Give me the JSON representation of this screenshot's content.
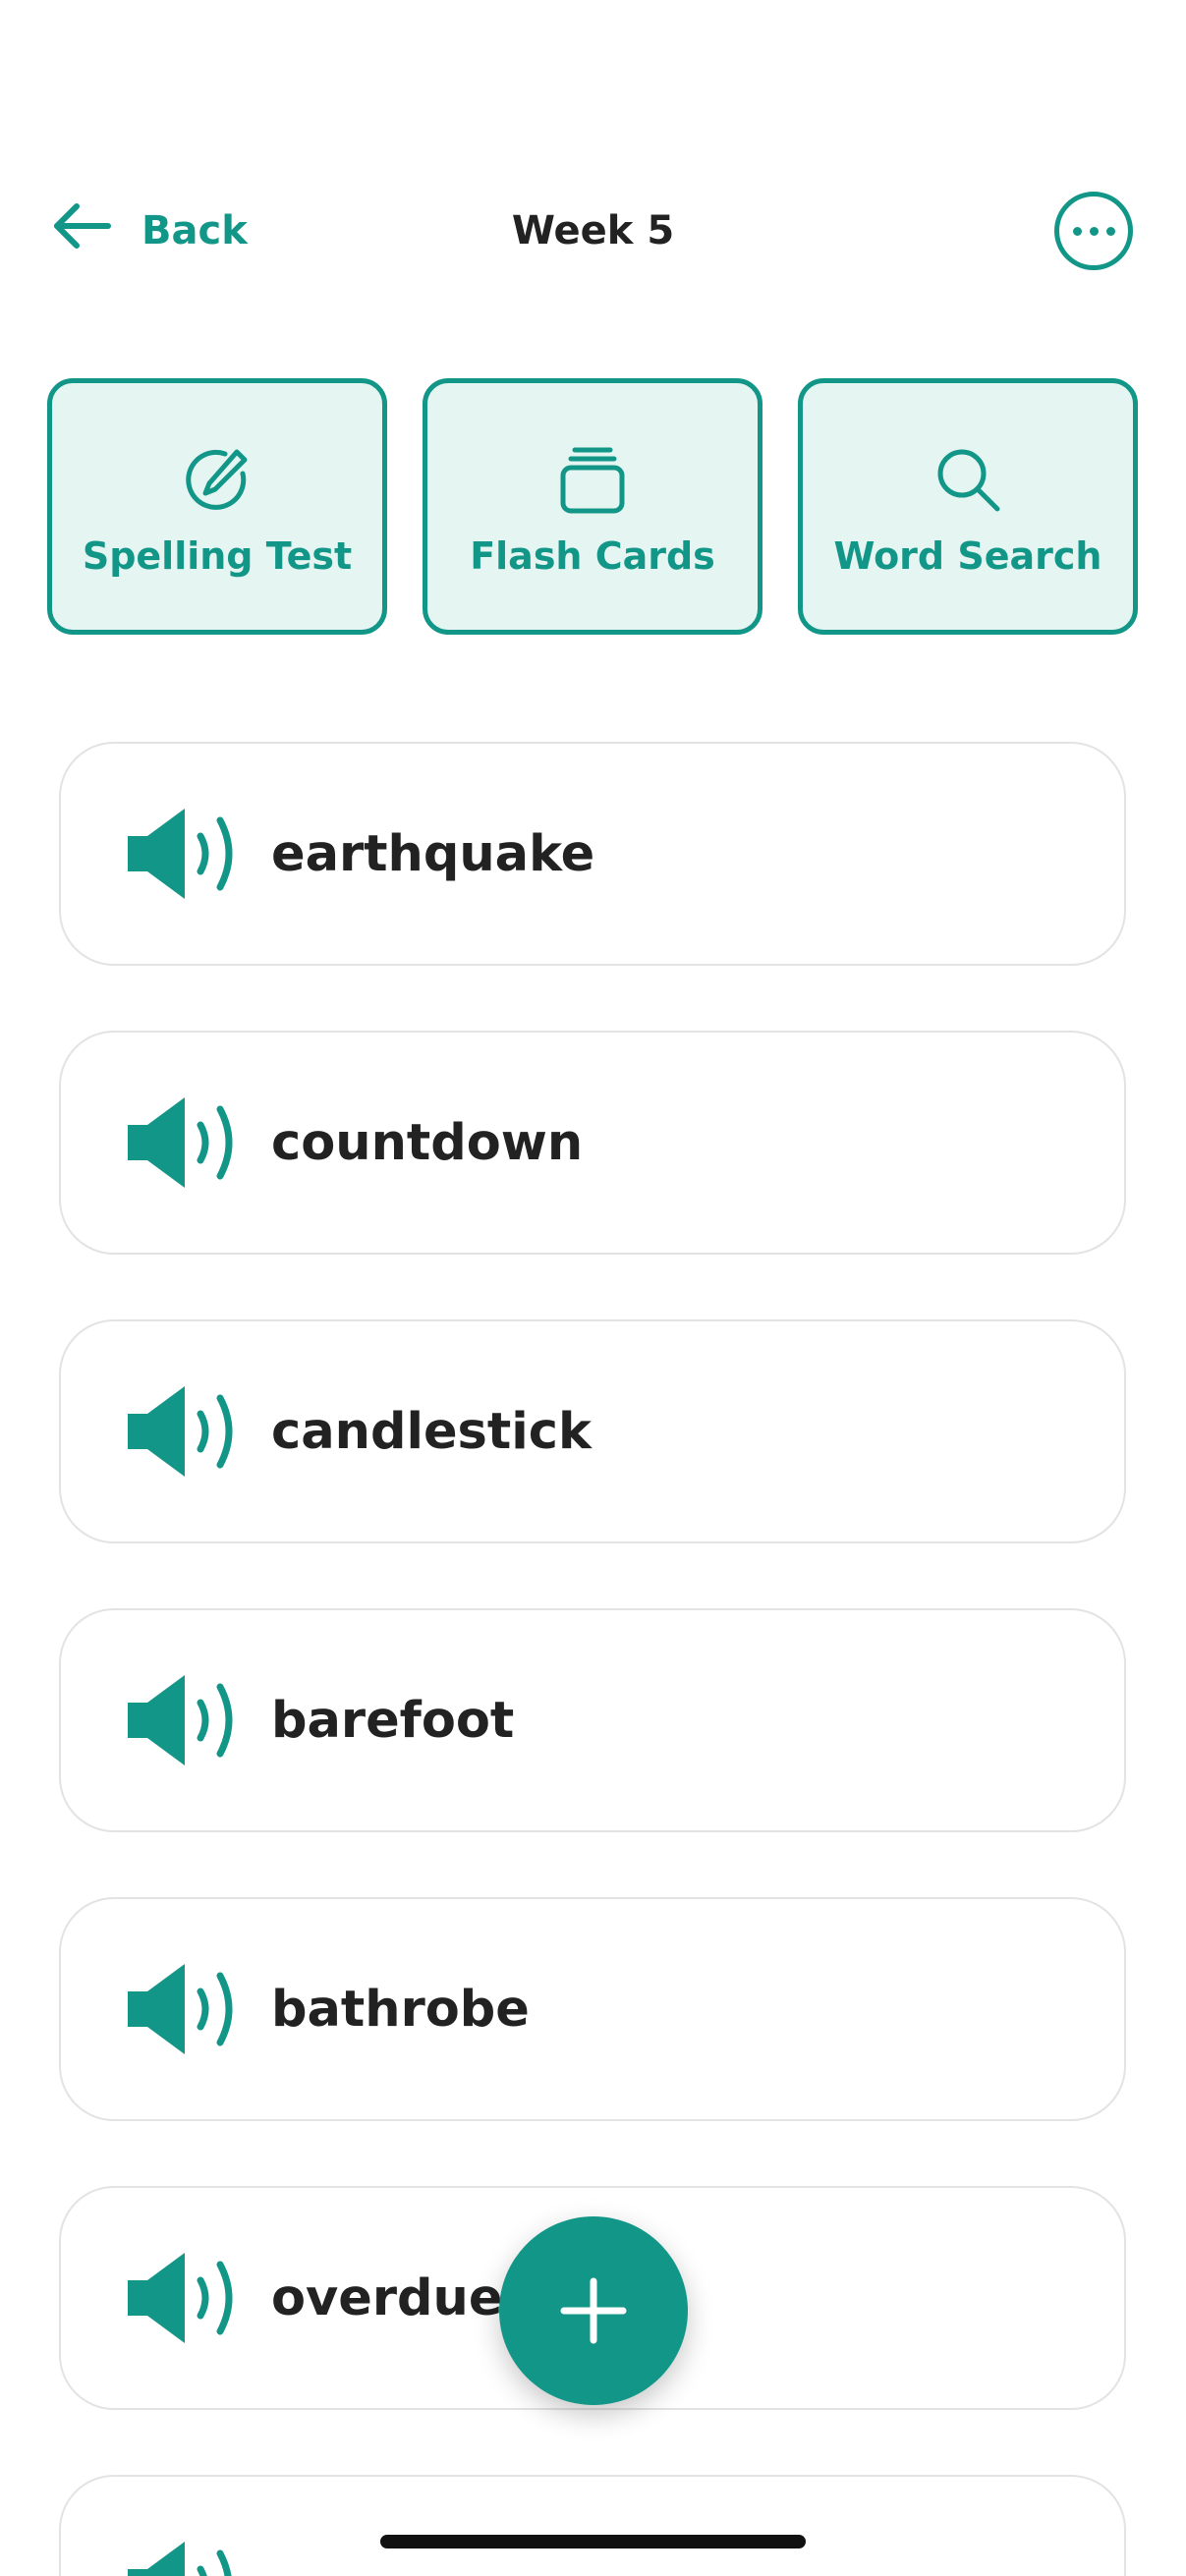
{
  "header": {
    "back_label": "Back",
    "title": "Week 5"
  },
  "activities": [
    {
      "label": "Spelling Test",
      "icon": "pencil-circle-icon"
    },
    {
      "label": "Flash Cards",
      "icon": "cards-stack-icon"
    },
    {
      "label": "Word Search",
      "icon": "search-icon"
    }
  ],
  "words": [
    "earthquake",
    "countdown",
    "candlestick",
    "barefoot",
    "bathrobe",
    "overdue",
    "..."
  ],
  "colors": {
    "accent": "#129688",
    "accent_light": "#e5f5f1",
    "text": "#222222",
    "border": "#e3e3e3"
  }
}
